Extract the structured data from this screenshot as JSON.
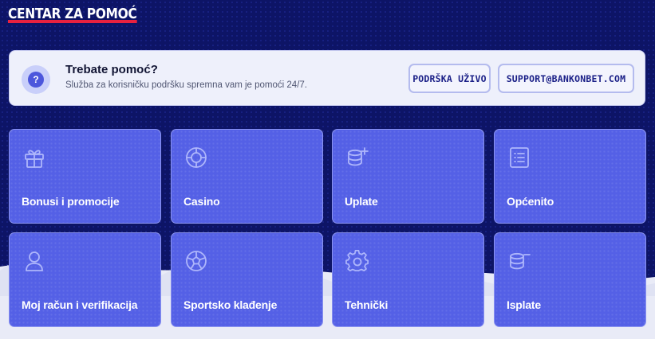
{
  "header": {
    "title": "CENTAR ZA POMOĆ"
  },
  "help_box": {
    "icon": "question-icon",
    "icon_glyph": "?",
    "title": "Trebate pomoć?",
    "subtitle": "Služba za korisničku podršku spremna vam je pomoći 24/7.",
    "live_support_label": "PODRŠKA UŽIVO",
    "email_label": "SUPPORT@BANKONBET.COM"
  },
  "categories": [
    {
      "label": "Bonusi i promocije",
      "icon": "gift-icon"
    },
    {
      "label": "Casino",
      "icon": "casino-chip-icon"
    },
    {
      "label": "Uplate",
      "icon": "coins-plus-icon"
    },
    {
      "label": "Općenito",
      "icon": "list-document-icon"
    },
    {
      "label": "Moj račun i verifikacija",
      "icon": "user-icon"
    },
    {
      "label": "Sportsko klađenje",
      "icon": "soccer-ball-icon"
    },
    {
      "label": "Tehnički",
      "icon": "gear-icon"
    },
    {
      "label": "Isplate",
      "icon": "coins-minus-icon"
    }
  ],
  "colors": {
    "background": "#0d1466",
    "card": "#5460e6",
    "accent_red": "#e8213f",
    "help_background": "#eef0fb",
    "button_text": "#1a1f87"
  }
}
